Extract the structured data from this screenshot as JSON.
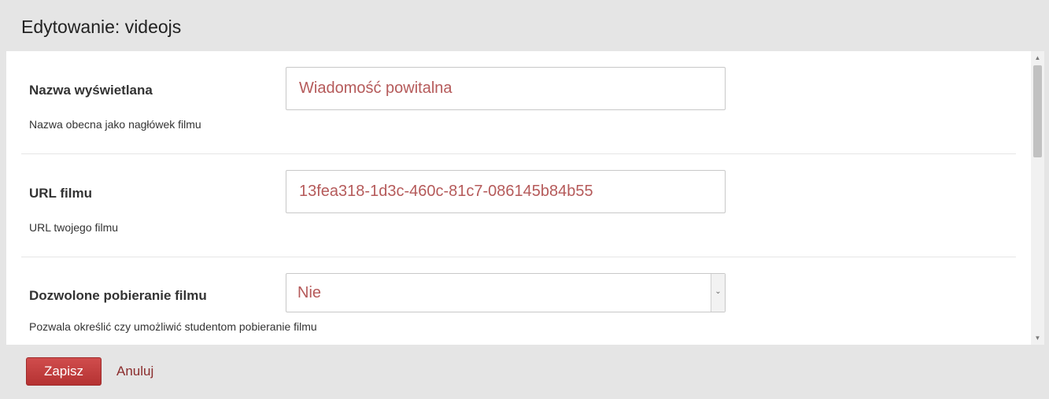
{
  "dialog": {
    "title": "Edytowanie: videojs"
  },
  "fields": [
    {
      "label": "Nazwa wyświetlana",
      "help": "Nazwa obecna jako nagłówek filmu",
      "value": "Wiadomość powitalna"
    },
    {
      "label": "URL filmu",
      "help": "URL twojego filmu",
      "value": "13fea318-1d3c-460c-81c7-086145b84b55"
    },
    {
      "label": "Dozwolone pobieranie filmu",
      "help": "Pozwala określić czy umożliwić studentom pobieranie filmu",
      "selected": "Nie"
    }
  ],
  "footer": {
    "save_label": "Zapisz",
    "cancel_label": "Anuluj"
  },
  "icons": {
    "select_arrow": "chevron-down-icon",
    "scroll_up": "arrow-up-icon",
    "scroll_down": "arrow-down-icon"
  },
  "colors": {
    "accent": "#c0392b",
    "value_text": "#b55a5a"
  }
}
